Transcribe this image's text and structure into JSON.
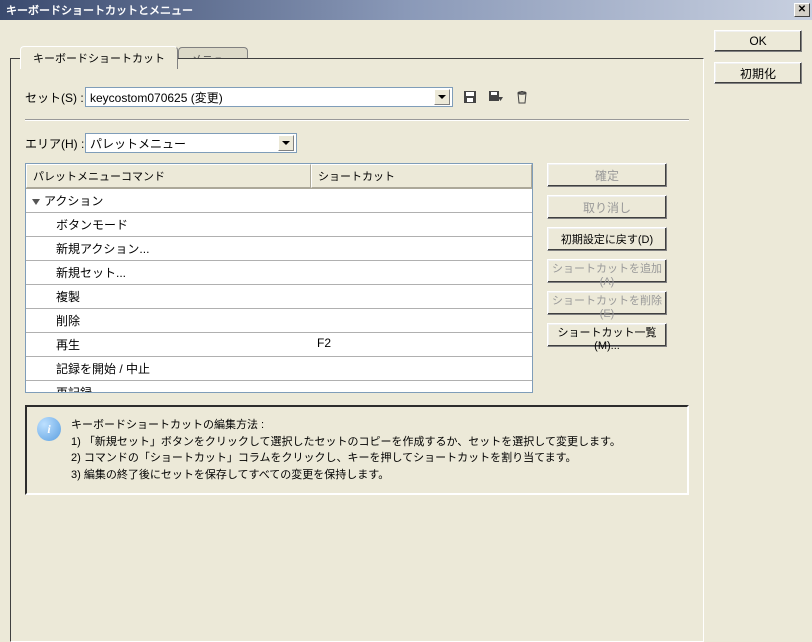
{
  "window": {
    "title": "キーボードショートカットとメニュー"
  },
  "right_buttons": {
    "ok": "OK",
    "reset": "初期化"
  },
  "tabs": {
    "shortcuts": "キーボードショートカット",
    "menus": "メニュー"
  },
  "set_row": {
    "label": "セット(S) :",
    "value": "keycostom070625 (変更)"
  },
  "area_row": {
    "label": "エリア(H) :",
    "value": "パレットメニュー"
  },
  "table": {
    "col1": "パレットメニューコマンド",
    "col2": "ショートカット",
    "group": "アクション",
    "rows": [
      {
        "cmd": "ボタンモード",
        "sc": ""
      },
      {
        "cmd": "新規アクション...",
        "sc": ""
      },
      {
        "cmd": "新規セット...",
        "sc": ""
      },
      {
        "cmd": "複製",
        "sc": ""
      },
      {
        "cmd": "削除",
        "sc": ""
      },
      {
        "cmd": "再生",
        "sc": "F2"
      },
      {
        "cmd": "記録を開始 / 中止",
        "sc": ""
      },
      {
        "cmd": "再記録...",
        "sc": ""
      }
    ]
  },
  "side": {
    "confirm": "確定",
    "cancel": "取り消し",
    "restore": "初期設定に戻す(D)",
    "add": "ショートカットを追加(A)",
    "delete": "ショートカットを削除(E)",
    "list": "ショートカット一覧(M)..."
  },
  "info": {
    "heading": "キーボードショートカットの編集方法 :",
    "line1": "1) 「新規セット」ボタンをクリックして選択したセットのコピーを作成するか、セットを選択して変更します。",
    "line2": "2) コマンドの「ショートカット」コラムをクリックし、キーを押してショートカットを割り当てます。",
    "line3": "3) 編集の終了後にセットを保存してすべての変更を保持します。"
  }
}
